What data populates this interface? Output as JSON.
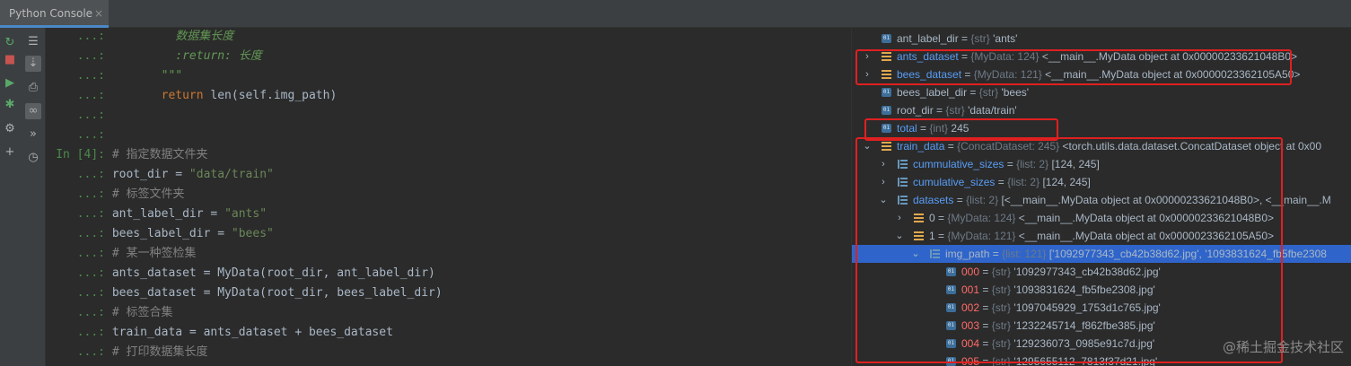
{
  "tab": {
    "title": "Python Console",
    "close": "×"
  },
  "toolbar": {
    "left": [
      {
        "name": "rerun-icon",
        "glyph": "↻",
        "color": "#59a869"
      },
      {
        "name": "stop-icon",
        "glyph": "■",
        "color": "#c75450"
      },
      {
        "name": "run-icon",
        "glyph": "▶",
        "color": "#59a869"
      },
      {
        "name": "debug-icon",
        "glyph": "✱",
        "color": "#59a869"
      },
      {
        "name": "settings-icon",
        "glyph": "⚙",
        "color": "#afb1b3"
      },
      {
        "name": "add-icon",
        "glyph": "+",
        "color": "#afb1b3"
      }
    ],
    "right": [
      {
        "name": "soft-wrap-icon",
        "glyph": "☰",
        "color": "#afb1b3",
        "sel": false
      },
      {
        "name": "scroll-to-end-icon",
        "glyph": "⇣",
        "color": "#afb1b3",
        "sel": true
      },
      {
        "name": "print-icon",
        "glyph": "⎙",
        "color": "#afb1b3",
        "sel": false
      },
      {
        "name": "show-variables-icon",
        "glyph": "∞",
        "color": "#afb1b3",
        "sel": true
      },
      {
        "name": "more-icon",
        "glyph": "»",
        "color": "#afb1b3",
        "sel": false
      },
      {
        "name": "history-icon",
        "glyph": "◷",
        "color": "#afb1b3",
        "sel": false
      }
    ]
  },
  "console": {
    "lines": [
      {
        "prompt": "...:",
        "parts": [
          [
            "cmi",
            "          数据集长度"
          ]
        ]
      },
      {
        "prompt": "...:",
        "parts": [
          [
            "cmi",
            "          :return: 长度"
          ]
        ]
      },
      {
        "prompt": "...:",
        "parts": [
          [
            "cmi",
            "        \"\"\""
          ]
        ]
      },
      {
        "prompt": "...:",
        "parts": [
          [
            "kw",
            "        return "
          ],
          [
            "tx",
            "len(self.img_path)"
          ]
        ]
      },
      {
        "prompt": "...:",
        "parts": []
      },
      {
        "prompt": "...:",
        "parts": []
      },
      {
        "prompt": "In [4]:",
        "parts": [
          [
            "cm",
            " # 指定数据文件夹"
          ]
        ]
      },
      {
        "prompt": "...:",
        "parts": [
          [
            "tx",
            " root_dir = "
          ],
          [
            "str",
            "\"data/train\""
          ]
        ]
      },
      {
        "prompt": "...:",
        "parts": [
          [
            "cm",
            " # 标签文件夹"
          ]
        ]
      },
      {
        "prompt": "...:",
        "parts": [
          [
            "tx",
            " ant_label_dir = "
          ],
          [
            "str",
            "\"ants\""
          ]
        ]
      },
      {
        "prompt": "...:",
        "parts": [
          [
            "tx",
            " bees_label_dir = "
          ],
          [
            "str",
            "\"bees\""
          ]
        ]
      },
      {
        "prompt": "...:",
        "parts": [
          [
            "cm",
            " # 某一种签检集"
          ]
        ]
      },
      {
        "prompt": "...:",
        "parts": [
          [
            "tx",
            " ants_dataset = MyData(root_dir, ant_label_dir)"
          ]
        ]
      },
      {
        "prompt": "...:",
        "parts": [
          [
            "tx",
            " bees_dataset = MyData(root_dir, bees_label_dir)"
          ]
        ]
      },
      {
        "prompt": "...:",
        "parts": [
          [
            "cm",
            " # 标签合集"
          ]
        ]
      },
      {
        "prompt": "...:",
        "parts": [
          [
            "tx",
            " train_data = ants_dataset + bees_dataset"
          ]
        ]
      },
      {
        "prompt": "...:",
        "parts": [
          [
            "cm",
            " # 打印数据集长度"
          ]
        ]
      }
    ]
  },
  "variables": [
    {
      "indent": 0,
      "arrow": "",
      "icon": "f",
      "name": "ant_label_dir",
      "nc": "",
      "type": "{str}",
      "value": "'ants'"
    },
    {
      "indent": 0,
      "arrow": "›",
      "icon": "o",
      "name": "ants_dataset",
      "nc": "blue",
      "type": "{MyData: 124}",
      "value": "<__main__.MyData object at 0x00000233621048B0>"
    },
    {
      "indent": 0,
      "arrow": "›",
      "icon": "o",
      "name": "bees_dataset",
      "nc": "blue",
      "type": "{MyData: 121}",
      "value": "<__main__.MyData object at 0x0000023362105A50>"
    },
    {
      "indent": 0,
      "arrow": "",
      "icon": "f",
      "name": "bees_label_dir",
      "nc": "",
      "type": "{str}",
      "value": "'bees'"
    },
    {
      "indent": 0,
      "arrow": "",
      "icon": "f",
      "name": "root_dir",
      "nc": "",
      "type": "{str}",
      "value": "'data/train'"
    },
    {
      "indent": 0,
      "arrow": "",
      "icon": "f",
      "name": "total",
      "nc": "blue",
      "type": "{int}",
      "value": "245"
    },
    {
      "indent": 0,
      "arrow": "⌄",
      "icon": "o",
      "name": "train_data",
      "nc": "blue",
      "type": "{ConcatDataset: 245}",
      "value": "<torch.utils.data.dataset.ConcatDataset object at 0x00"
    },
    {
      "indent": 1,
      "arrow": "›",
      "icon": "l",
      "name": "cummulative_sizes",
      "nc": "blue",
      "type": "{list: 2}",
      "value": "[124, 245]"
    },
    {
      "indent": 1,
      "arrow": "›",
      "icon": "l",
      "name": "cumulative_sizes",
      "nc": "blue",
      "type": "{list: 2}",
      "value": "[124, 245]"
    },
    {
      "indent": 1,
      "arrow": "⌄",
      "icon": "l",
      "name": "datasets",
      "nc": "blue",
      "type": "{list: 2}",
      "value": "[<__main__.MyData object at 0x00000233621048B0>, <__main__.M"
    },
    {
      "indent": 2,
      "arrow": "›",
      "icon": "o",
      "name": "0",
      "nc": "",
      "type": "{MyData: 124}",
      "value": "<__main__.MyData object at 0x00000233621048B0>"
    },
    {
      "indent": 2,
      "arrow": "⌄",
      "icon": "o",
      "name": "1",
      "nc": "",
      "type": "{MyData: 121}",
      "value": "<__main__.MyData object at 0x0000023362105A50>"
    },
    {
      "indent": 3,
      "arrow": "⌄",
      "icon": "l",
      "name": "img_path",
      "nc": "",
      "type": "{list: 121}",
      "value": "['1092977343_cb42b38d62.jpg', '1093831624_fb5fbe2308",
      "sel": true
    },
    {
      "indent": 4,
      "arrow": "",
      "icon": "f",
      "name": "000",
      "nc": "red",
      "type": "{str}",
      "value": "'1092977343_cb42b38d62.jpg'"
    },
    {
      "indent": 4,
      "arrow": "",
      "icon": "f",
      "name": "001",
      "nc": "red",
      "type": "{str}",
      "value": "'1093831624_fb5fbe2308.jpg'"
    },
    {
      "indent": 4,
      "arrow": "",
      "icon": "f",
      "name": "002",
      "nc": "red",
      "type": "{str}",
      "value": "'1097045929_1753d1c765.jpg'"
    },
    {
      "indent": 4,
      "arrow": "",
      "icon": "f",
      "name": "003",
      "nc": "red",
      "type": "{str}",
      "value": "'1232245714_f862fbe385.jpg'"
    },
    {
      "indent": 4,
      "arrow": "",
      "icon": "f",
      "name": "004",
      "nc": "red",
      "type": "{str}",
      "value": "'129236073_0985e91c7d.jpg'"
    },
    {
      "indent": 4,
      "arrow": "",
      "icon": "f",
      "name": "005",
      "nc": "red",
      "type": "{str}",
      "value": "'1295655112_7813f37d21.jpg'"
    }
  ],
  "watermark": "@稀土掘金技术社区"
}
